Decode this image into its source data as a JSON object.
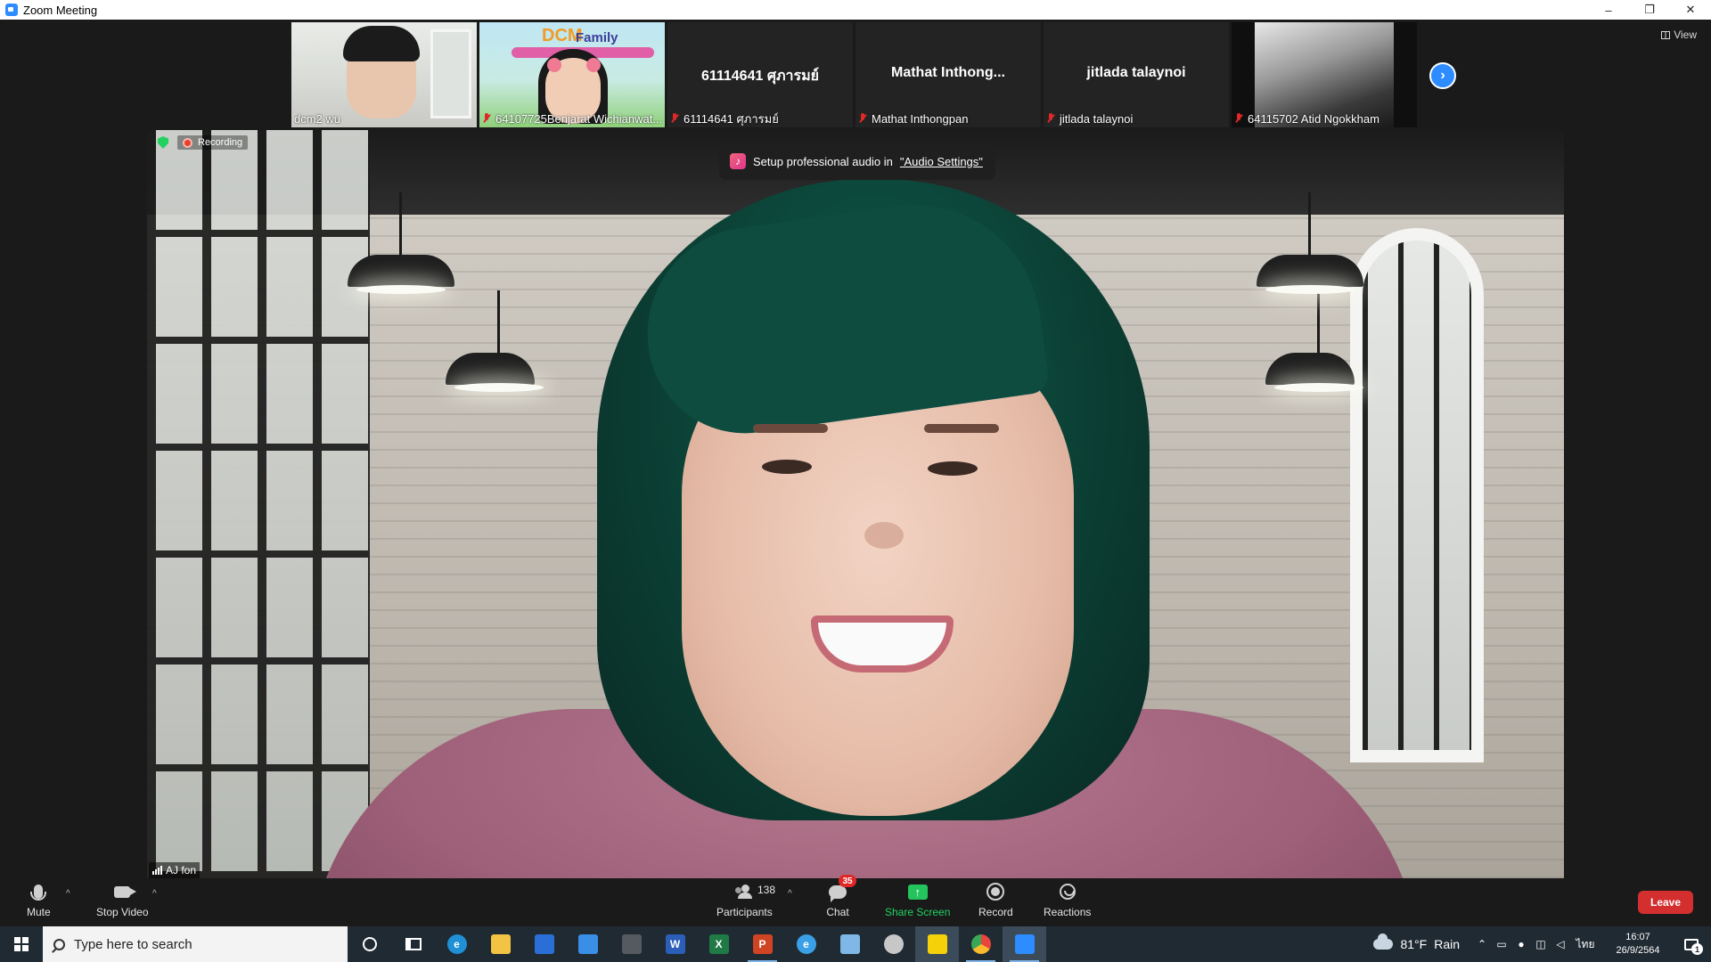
{
  "window": {
    "title": "Zoom Meeting",
    "minimize": "–",
    "restore": "❐",
    "close": "✕"
  },
  "thumbnails": [
    {
      "name": "dcm2 wu",
      "type": "video",
      "muted": false
    },
    {
      "name": "64107725Benjarat Wichianwat...",
      "type": "video",
      "muted": true,
      "banner": "DCM",
      "banner2": "Family"
    },
    {
      "name": "61114641 ศุภารมย์",
      "big_name": "61114641 ศุภารมย์",
      "type": "name",
      "muted": true
    },
    {
      "name": "Mathat Inthongpan",
      "big_name": "Mathat  Inthong...",
      "type": "name",
      "muted": true
    },
    {
      "name": "jitlada talaynoi",
      "big_name": "jitlada talaynoi",
      "type": "name",
      "muted": true
    },
    {
      "name": "64115702 Atid Ngokkham",
      "type": "video",
      "muted": true
    }
  ],
  "next_page_icon": "›",
  "view_button": "View",
  "recording_label": "Recording",
  "audio_toast": {
    "prefix": "Setup professional audio in ",
    "link": "\"Audio Settings\"",
    "icon": "♪"
  },
  "active_speaker": "AJ fon",
  "controls": {
    "mute": "Mute",
    "stop_video": "Stop Video",
    "participants": "Participants",
    "participants_count": "138",
    "chat": "Chat",
    "chat_badge": "35",
    "share_screen": "Share Screen",
    "share_icon": "↑",
    "record": "Record",
    "reactions": "Reactions",
    "leave": "Leave",
    "caret": "^"
  },
  "taskbar": {
    "search_placeholder": "Type here to search",
    "apps": [
      {
        "name": "edge",
        "glyph": "e",
        "color": "#1f8fd6"
      },
      {
        "name": "file-explorer",
        "glyph": "",
        "color": "#f3c343"
      },
      {
        "name": "store",
        "glyph": "",
        "color": "#2a6fd6"
      },
      {
        "name": "mail",
        "glyph": "",
        "color": "#3a8ee6"
      },
      {
        "name": "app",
        "glyph": "",
        "color": "#555a60"
      },
      {
        "name": "word",
        "glyph": "W",
        "color": "#2b5eb8"
      },
      {
        "name": "excel",
        "glyph": "X",
        "color": "#1f7a45"
      },
      {
        "name": "powerpoint",
        "glyph": "P",
        "color": "#d04423"
      },
      {
        "name": "internet-explorer",
        "glyph": "e",
        "color": "#3aa0e6"
      },
      {
        "name": "app2",
        "glyph": "",
        "color": "#7fb8e6"
      },
      {
        "name": "app3",
        "glyph": "",
        "color": "#c7c7c7"
      },
      {
        "name": "sticky-notes",
        "glyph": "",
        "color": "#f5d10a"
      },
      {
        "name": "chrome",
        "glyph": "",
        "color": "#e8453c"
      },
      {
        "name": "zoom",
        "glyph": "",
        "color": "#2d8cff"
      }
    ],
    "weather_temp": "81°F",
    "weather_text": "Rain",
    "language": "ไทย",
    "time": "16:07",
    "date": "26/9/2564",
    "notifications": "1"
  },
  "colors": {
    "zoom_blue": "#2d8cff",
    "leave_red": "#d32f2f",
    "share_green": "#23c45e",
    "muted_red": "#e02828"
  }
}
